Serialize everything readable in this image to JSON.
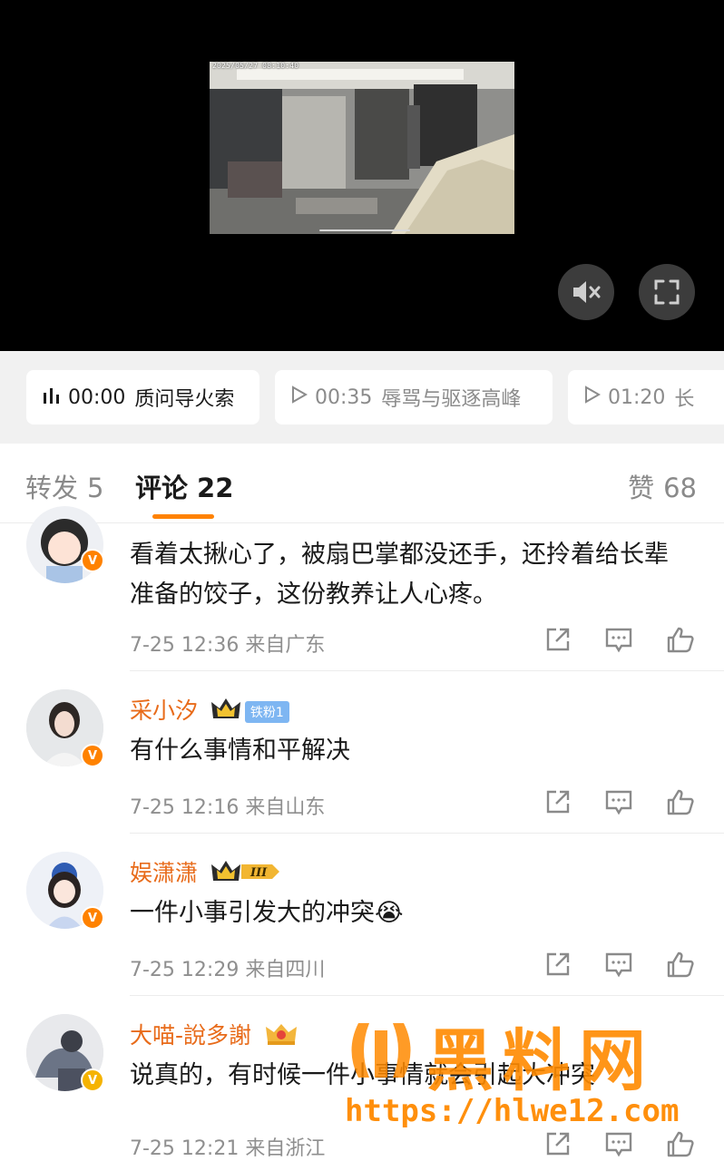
{
  "video": {
    "timestamp": "2025/05/27 08:10:40",
    "mute_icon": "speaker-muted-icon",
    "fullscreen_icon": "fullscreen-icon"
  },
  "chapters": [
    {
      "time": "00:00",
      "title": "质问导火索",
      "active": true
    },
    {
      "time": "00:35",
      "title": "辱骂与驱逐高峰",
      "active": false
    },
    {
      "time": "01:20",
      "title": "长",
      "active": false
    }
  ],
  "tabs": {
    "repost": {
      "label": "转发",
      "count": "5"
    },
    "comment": {
      "label": "评论",
      "count": "22"
    },
    "like": {
      "label": "赞",
      "count": "68"
    }
  },
  "comments": [
    {
      "username": "",
      "text": "看着太揪心了，被扇巴掌都没还手，还拎着给长辈准备的饺子，这份教养让人心疼。",
      "time": "7-25 12:36",
      "location": "来自广东",
      "badge": "v"
    },
    {
      "username": "采小汐",
      "fan_badge": "铁粉1",
      "text": "有什么事情和平解决",
      "time": "7-25 12:16",
      "location": "来自山东",
      "badge": "v"
    },
    {
      "username": "娱潇潇",
      "level_badge": "III",
      "text": "一件小事引发大的冲突😭",
      "time": "7-25 12:29",
      "location": "来自四川",
      "badge": "v"
    },
    {
      "username": "大喵-說多謝",
      "text": "说真的，有时候一件小事情就会引起大冲突",
      "time": "7-25 12:21",
      "location": "来自浙江",
      "badge": "v"
    }
  ],
  "watermark": {
    "title": "黑料网",
    "url": "https://hlwe12.com"
  },
  "colors": {
    "accent": "#ff8200",
    "username": "#e86b1a",
    "meta": "#8f8f8f"
  }
}
